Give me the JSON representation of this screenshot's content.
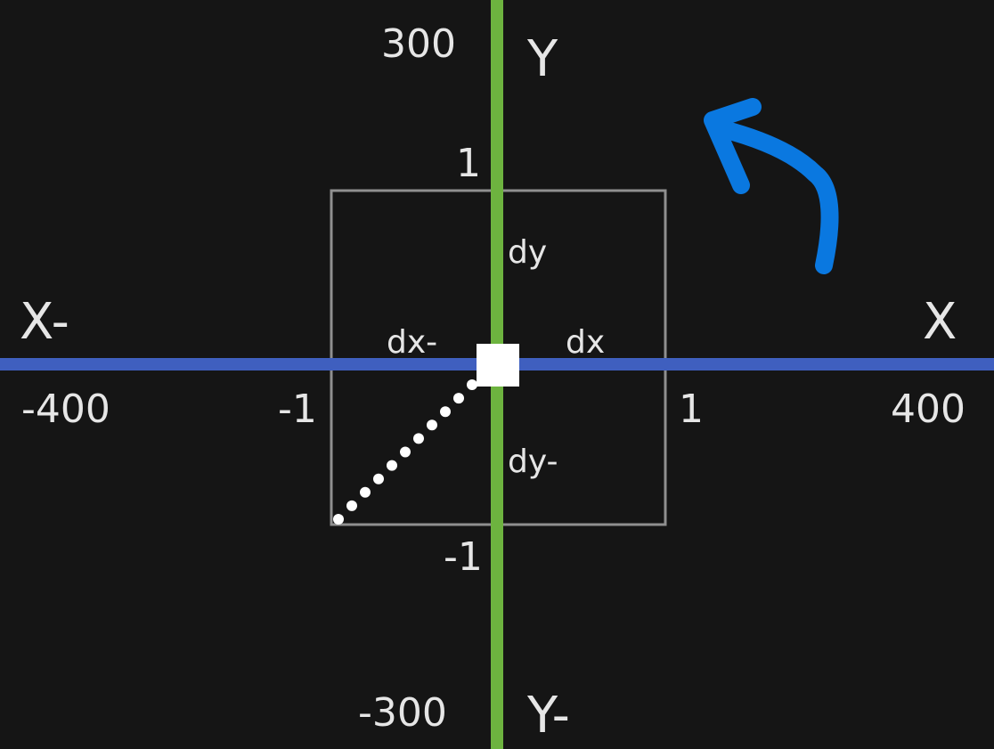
{
  "axes": {
    "x_neg_label": "X-",
    "x_pos_label": "X",
    "y_pos_label": "Y",
    "y_neg_label": "Y-",
    "x_min": "-400",
    "x_max": "400",
    "y_max": "300",
    "y_min": "-300"
  },
  "unit_box": {
    "x_neg": "-1",
    "x_pos": "1",
    "y_pos": "1",
    "y_neg": "-1",
    "dx_neg": "dx-",
    "dx_pos": "dx",
    "dy_pos": "dy",
    "dy_neg": "dy-"
  },
  "colors": {
    "background": "#151515",
    "x_axis": "#3f5fbf",
    "y_axis": "#6db33f",
    "box": "#9a9a9a",
    "text": "#e6e6e6",
    "annotation_arrow": "#0a78e0"
  },
  "icons": {
    "origin_marker": "white-square",
    "direction_path": "dotted-diagonal",
    "annotation": "curved-arrow"
  }
}
